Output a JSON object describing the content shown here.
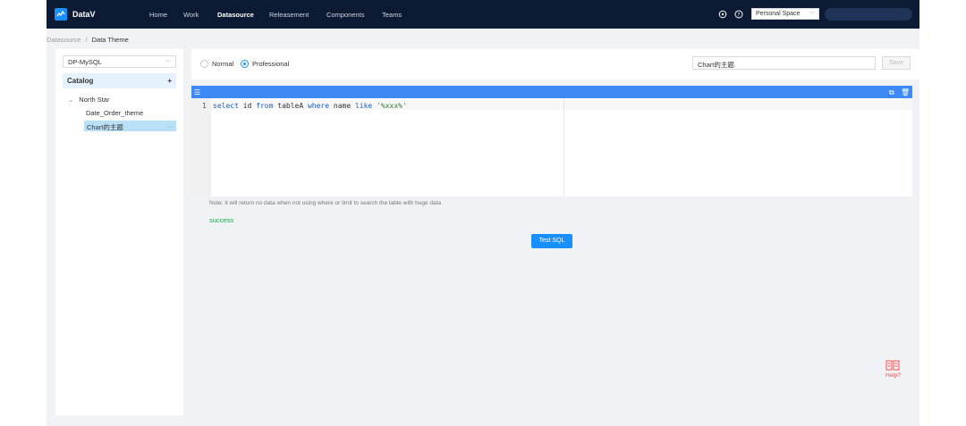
{
  "header": {
    "brand": "DataV",
    "nav": [
      "Home",
      "Work",
      "Datasource",
      "Releasement",
      "Components",
      "Teams"
    ],
    "active_nav": "Datasource",
    "space": "Personal Space",
    "icons": [
      "feedback-icon",
      "help-circle-icon"
    ]
  },
  "breadcrumb": {
    "root": "Datasource",
    "separator": "/",
    "current": "Data Theme"
  },
  "sidebar": {
    "datasource": "DP-MySQL",
    "catalog_label": "Catalog",
    "add_label": "+",
    "tree": {
      "root": "North Star",
      "children": [
        "Date_Order_theme",
        "Chart的主题"
      ],
      "more": "···"
    }
  },
  "toolbar": {
    "mode_normal": "Normal",
    "mode_professional": "Professional",
    "selected_mode": "Professional",
    "theme_name": "Chart的主题",
    "save_label": "Save"
  },
  "editor": {
    "line_number": "1",
    "sql": {
      "t1": "select",
      "t2": " id ",
      "t3": "from",
      "t4": " tableA ",
      "t5": "where",
      "t6": " name ",
      "t7": "like",
      "t8": " ",
      "t9": "'%xxx%'"
    },
    "colors": {
      "keyword": "#1a5ec7",
      "string": "#2e7d32",
      "bar": "#3d8af7"
    }
  },
  "result": {
    "note": "Note: it will return no data when not using where or limit to search the table with huge data",
    "status": "success",
    "status_color": "#27a050",
    "test_button": "Test SQL"
  },
  "help": {
    "label": "Help?",
    "color": "#f0504a"
  }
}
